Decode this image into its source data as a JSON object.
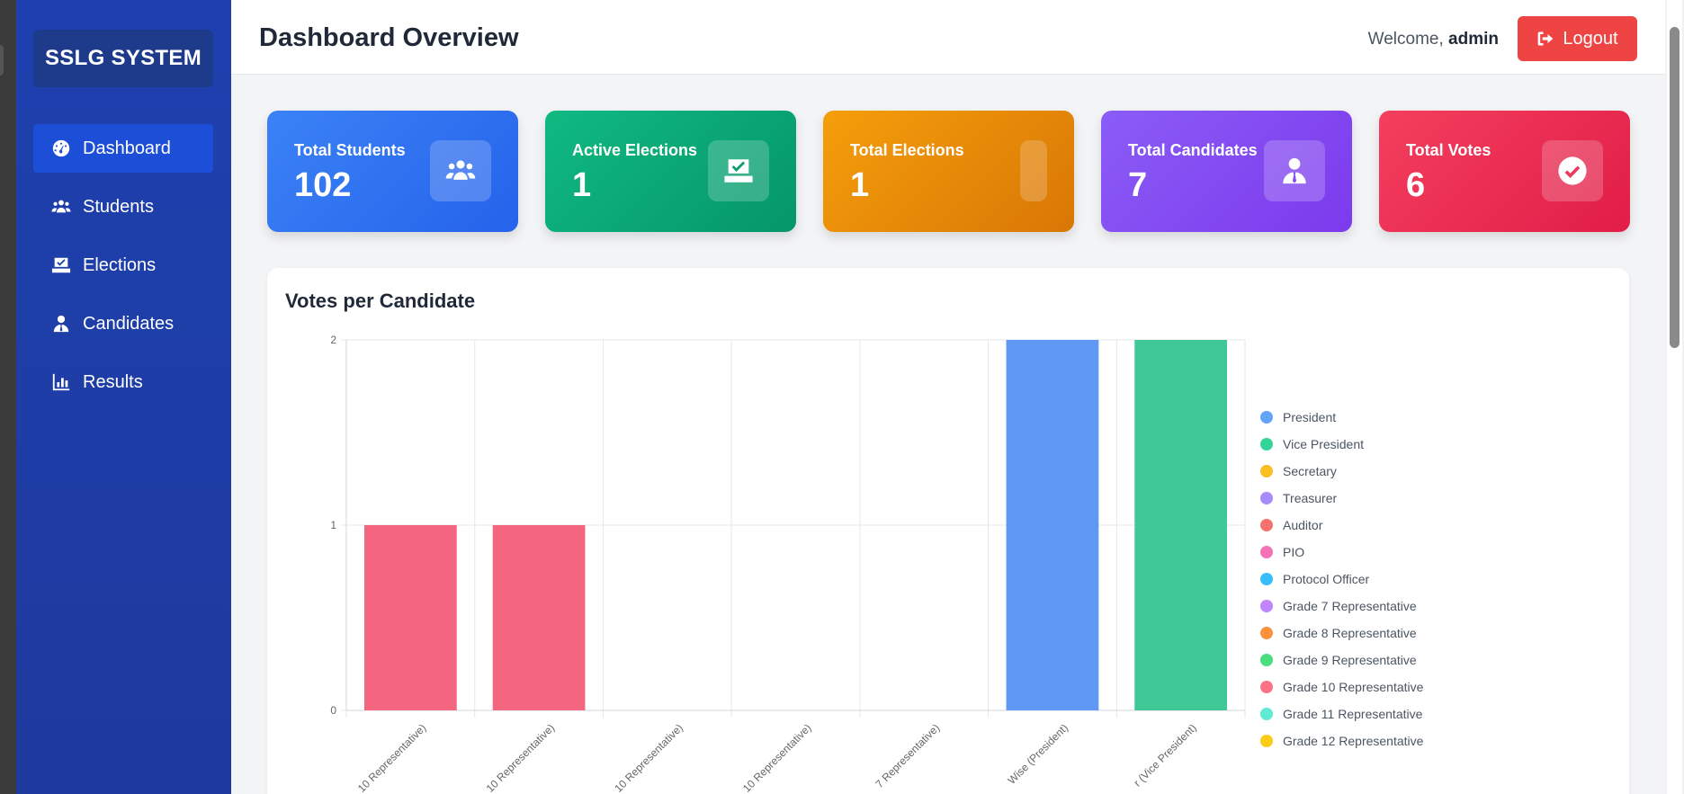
{
  "sidebar": {
    "brand": "SSLG SYSTEM",
    "items": [
      {
        "label": "Dashboard",
        "icon": "gauge-icon",
        "active": true
      },
      {
        "label": "Students",
        "icon": "users-icon",
        "active": false
      },
      {
        "label": "Elections",
        "icon": "ballot-box-icon",
        "active": false
      },
      {
        "label": "Candidates",
        "icon": "user-tie-icon",
        "active": false
      },
      {
        "label": "Results",
        "icon": "bar-chart-icon",
        "active": false
      }
    ]
  },
  "header": {
    "title": "Dashboard Overview",
    "welcome_prefix": "Welcome,",
    "username": "admin",
    "logout_label": "Logout"
  },
  "stats": [
    {
      "label": "Total Students",
      "value": "102",
      "color_from": "#3b82f6",
      "color_to": "#2563eb",
      "icon": "users-icon"
    },
    {
      "label": "Active Elections",
      "value": "1",
      "color_from": "#10b981",
      "color_to": "#059669",
      "icon": "ballot-box-icon"
    },
    {
      "label": "Total Elections",
      "value": "1",
      "color_from": "#f59e0b",
      "color_to": "#d97706",
      "icon": "box-icon"
    },
    {
      "label": "Total Candidates",
      "value": "7",
      "color_from": "#8b5cf6",
      "color_to": "#7c3aed",
      "icon": "user-tie-icon"
    },
    {
      "label": "Total Votes",
      "value": "6",
      "color_from": "#f43f5e",
      "color_to": "#e11d48",
      "icon": "check-circle-icon"
    }
  ],
  "chart_panel": {
    "title": "Votes per Candidate"
  },
  "chart_data": {
    "type": "bar",
    "title": "Votes per Candidate",
    "categories": [
      "10 Representative)",
      "10 Representative)",
      "10 Representative)",
      "10 Representative)",
      "7 Representative)",
      "Wise (President)",
      "r (Vice President)"
    ],
    "values": [
      1,
      1,
      0,
      0,
      0,
      2,
      2
    ],
    "bar_colors": [
      "#f4667f",
      "#f4667f",
      "#f4667f",
      "#f4667f",
      "#a875f2",
      "#6098f6",
      "#40c996"
    ],
    "ylim": [
      0,
      2
    ],
    "yticks": [
      "0",
      "1",
      "2"
    ],
    "grid": true,
    "legend_position": "right",
    "legend": [
      {
        "name": "President",
        "color": "#60a5fa"
      },
      {
        "name": "Vice President",
        "color": "#34d399"
      },
      {
        "name": "Secretary",
        "color": "#fbbf24"
      },
      {
        "name": "Treasurer",
        "color": "#a78bfa"
      },
      {
        "name": "Auditor",
        "color": "#f87171"
      },
      {
        "name": "PIO",
        "color": "#f472b6"
      },
      {
        "name": "Protocol Officer",
        "color": "#38bdf8"
      },
      {
        "name": "Grade 7 Representative",
        "color": "#c084fc"
      },
      {
        "name": "Grade 8 Representative",
        "color": "#fb923c"
      },
      {
        "name": "Grade 9 Representative",
        "color": "#4ade80"
      },
      {
        "name": "Grade 10 Representative",
        "color": "#fb7185"
      },
      {
        "name": "Grade 11 Representative",
        "color": "#5eead4"
      },
      {
        "name": "Grade 12 Representative",
        "color": "#facc15"
      }
    ]
  }
}
